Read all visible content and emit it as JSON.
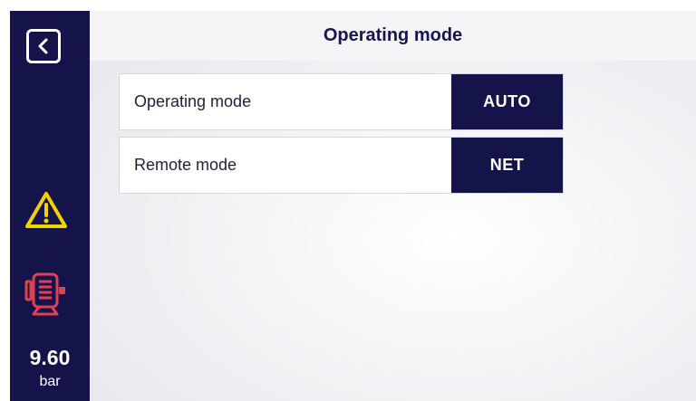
{
  "header": {
    "title": "Operating mode"
  },
  "sidebar": {
    "back_icon": "chevron-left-icon",
    "warning_icon": "warning-triangle-icon",
    "motor_icon": "motor-icon",
    "pressure_value": "9.60",
    "pressure_unit": "bar"
  },
  "settings": [
    {
      "label": "Operating mode",
      "value": "AUTO"
    },
    {
      "label": "Remote mode",
      "value": "NET"
    }
  ],
  "colors": {
    "navy": "#15144a",
    "warning": "#f2d200",
    "alarm": "#e0404f",
    "header_text": "#17164f"
  }
}
